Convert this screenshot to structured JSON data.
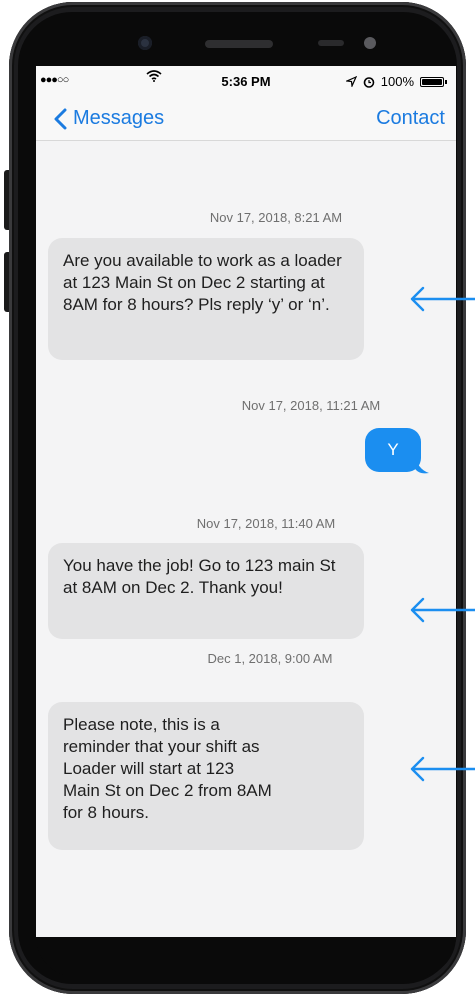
{
  "status_bar": {
    "time": "5:36 PM",
    "battery": "100%",
    "signal_icon": "signal-dots-icon",
    "wifi_icon": "wifi-icon"
  },
  "nav": {
    "back_label": "Messages",
    "contact_label": "Contact"
  },
  "messages": [
    {
      "timestamp": "Nov 17, 2018, 8:21 AM",
      "direction": "incoming",
      "text": "Are you available to work as a loader at 123 Main St on Dec 2 starting at 8AM for 8 hours? Pls reply ‘y’ or ‘n’."
    },
    {
      "timestamp": "Nov 17, 2018, 11:21 AM",
      "direction": "outgoing",
      "text": "Y"
    },
    {
      "timestamp": "Nov 17, 2018, 11:40 AM",
      "direction": "incoming",
      "text": "You have the job! Go to 123 main St at 8AM on Dec 2. Thank you!"
    },
    {
      "timestamp": "Dec 1, 2018, 9:00 AM",
      "direction": "incoming",
      "text": "Please note, this is a reminder that your shift as Loader will start at 123 Main St on Dec 2 from 8AM for 8 hours."
    }
  ],
  "colors": {
    "ios_blue": "#1b7be0",
    "outgoing_bubble": "#1b8ef0",
    "incoming_bubble": "#e3e3e4",
    "annotation_arrow": "#1b8ef0"
  }
}
